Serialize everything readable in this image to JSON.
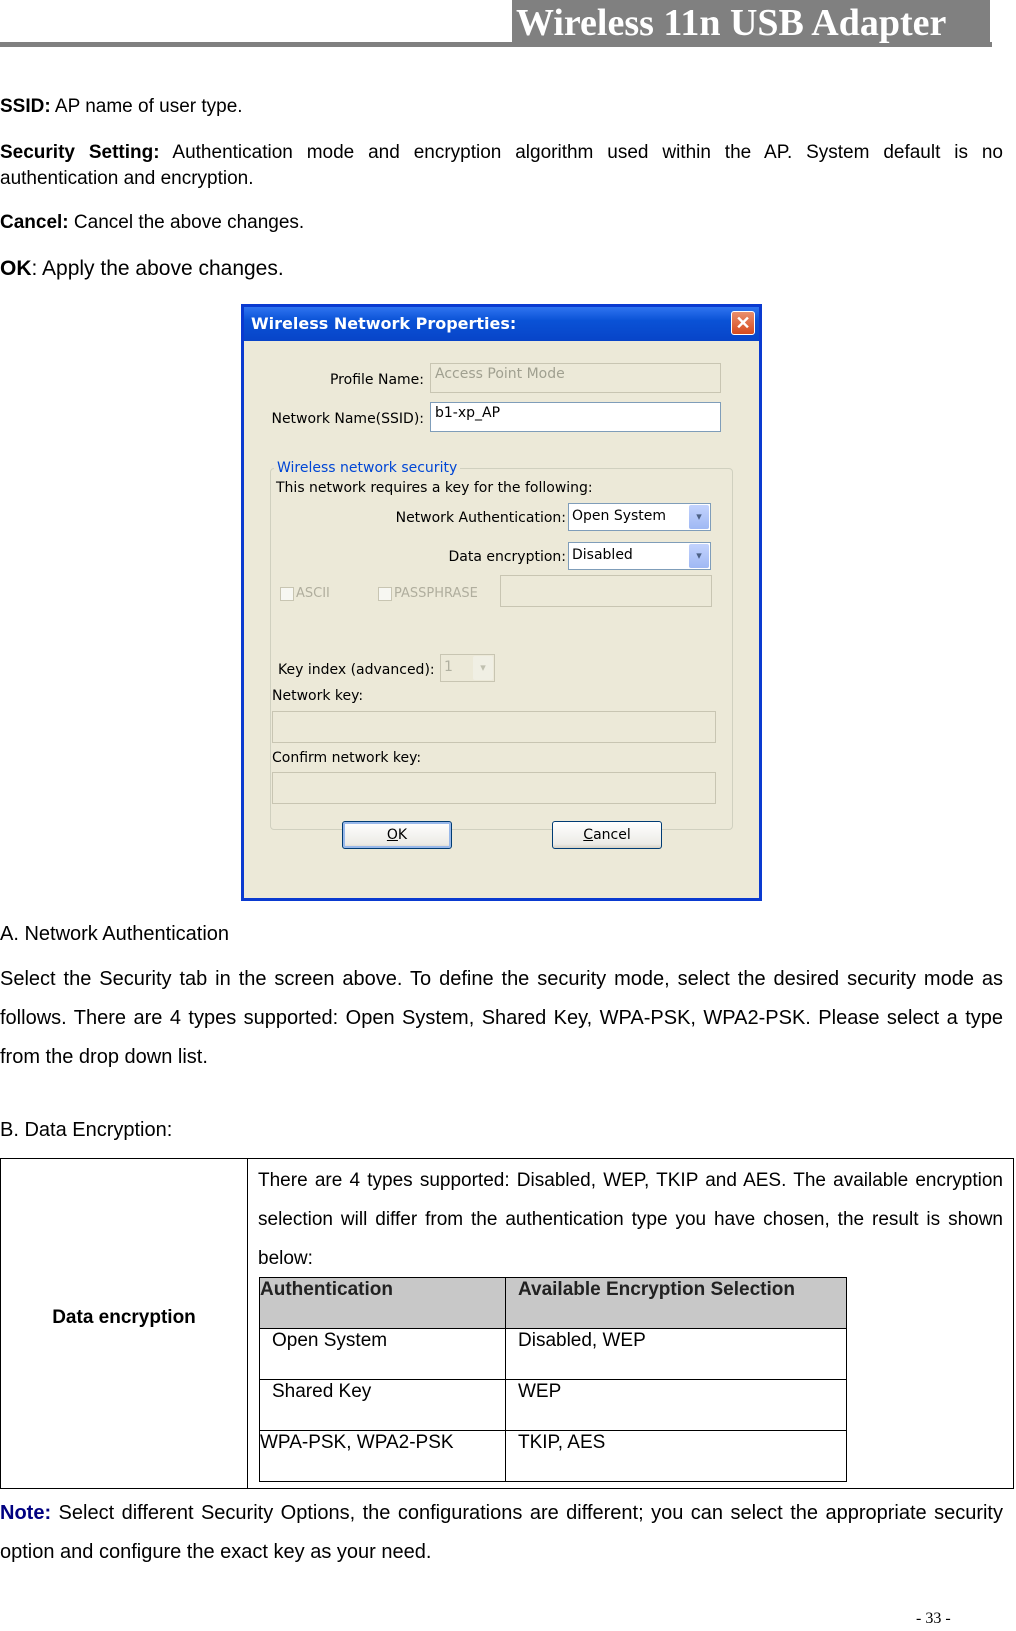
{
  "header": {
    "title": "Wireless 11n USB Adapter"
  },
  "intro": {
    "ssid": {
      "label": "SSID:",
      "text": " AP name of user type."
    },
    "security": {
      "label": "Security Setting:",
      "text": " Authentication mode and encryption algorithm used within the AP. System default is no authentication and encryption."
    },
    "cancel": {
      "label": "Cancel:",
      "text": " Cancel the above changes."
    },
    "ok": {
      "label": "OK",
      "text": ": Apply the above changes."
    }
  },
  "dialog": {
    "title": "Wireless Network Properties:",
    "close_glyph": "✕",
    "profile_name_label": "Profile Name:",
    "profile_name_value": "Access Point Mode",
    "ssid_label": "Network Name(SSID):",
    "ssid_value": "b1-xp_AP",
    "security_group": "Wireless network security",
    "requires_key_text": "This network requires a key for the following:",
    "auth_label": "Network Authentication:",
    "auth_value": "Open System",
    "encryption_label": "Data encryption:",
    "encryption_value": "Disabled",
    "ascii_label": "ASCII",
    "passphrase_label": "PASSPHRASE",
    "key_index_label": "Key index (advanced):",
    "key_index_value": "1",
    "network_key_label": "Network key:",
    "confirm_key_label": "Confirm network key:",
    "ok_button": {
      "mnemonic": "O",
      "rest": "K"
    },
    "cancel_button": {
      "mnemonic": "C",
      "rest": "ancel"
    },
    "dropdown_glyph": "▾"
  },
  "section_a": {
    "heading": "A. Network Authentication",
    "body": "Select the Security tab in the screen above. To define the security mode, select the desired security mode as follows. There are 4 types supported: Open System, Shared Key, WPA-PSK, WPA2-PSK. Please select a type from the drop down list."
  },
  "section_b": {
    "heading": "B. Data Encryption:"
  },
  "encryption_table": {
    "row_label": "Data encryption",
    "description": "There are 4 types supported: Disabled, WEP, TKIP and AES. The available encryption selection will differ from the authentication type you have chosen, the result is shown below:",
    "columns": [
      "Authentication",
      "Available Encryption Selection"
    ],
    "rows": [
      [
        "Open System",
        "Disabled, WEP"
      ],
      [
        "Shared Key",
        "WEP"
      ],
      [
        "WPA-PSK, WPA2-PSK",
        "TKIP, AES"
      ]
    ]
  },
  "note": {
    "label": "Note:",
    "text": " Select different Security Options, the configurations are different; you can select the appropriate security option and configure the exact key as your need."
  },
  "page_number": "- 33 -"
}
